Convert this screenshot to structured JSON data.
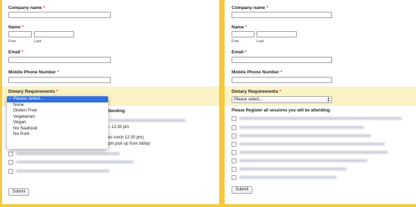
{
  "form": {
    "company_label": "Company name",
    "name_label": "Name",
    "first_label": "First",
    "last_label": "Last",
    "email_label": "Email",
    "phone_label": "Mobile Phone Number",
    "dietary_label": "Dietary Requirements",
    "required_mark": "*",
    "select_value": "Please select...",
    "sessions_label": "Please Register all sessions you will be attending:",
    "sessions_label_partial": "ttending:",
    "submit_label": "Submit"
  },
  "dropdown": {
    "options": [
      "Please select...",
      "None",
      "Gluten Free",
      "Vegetarian",
      "Vegan",
      "No Seafood",
      "No Pork"
    ],
    "selected_index": 0
  },
  "session_fragments": {
    "f1": "– 12:30 pm",
    "f2": "es lunch 12:30 pm)",
    "f3": "pm pick up from lobby)"
  }
}
